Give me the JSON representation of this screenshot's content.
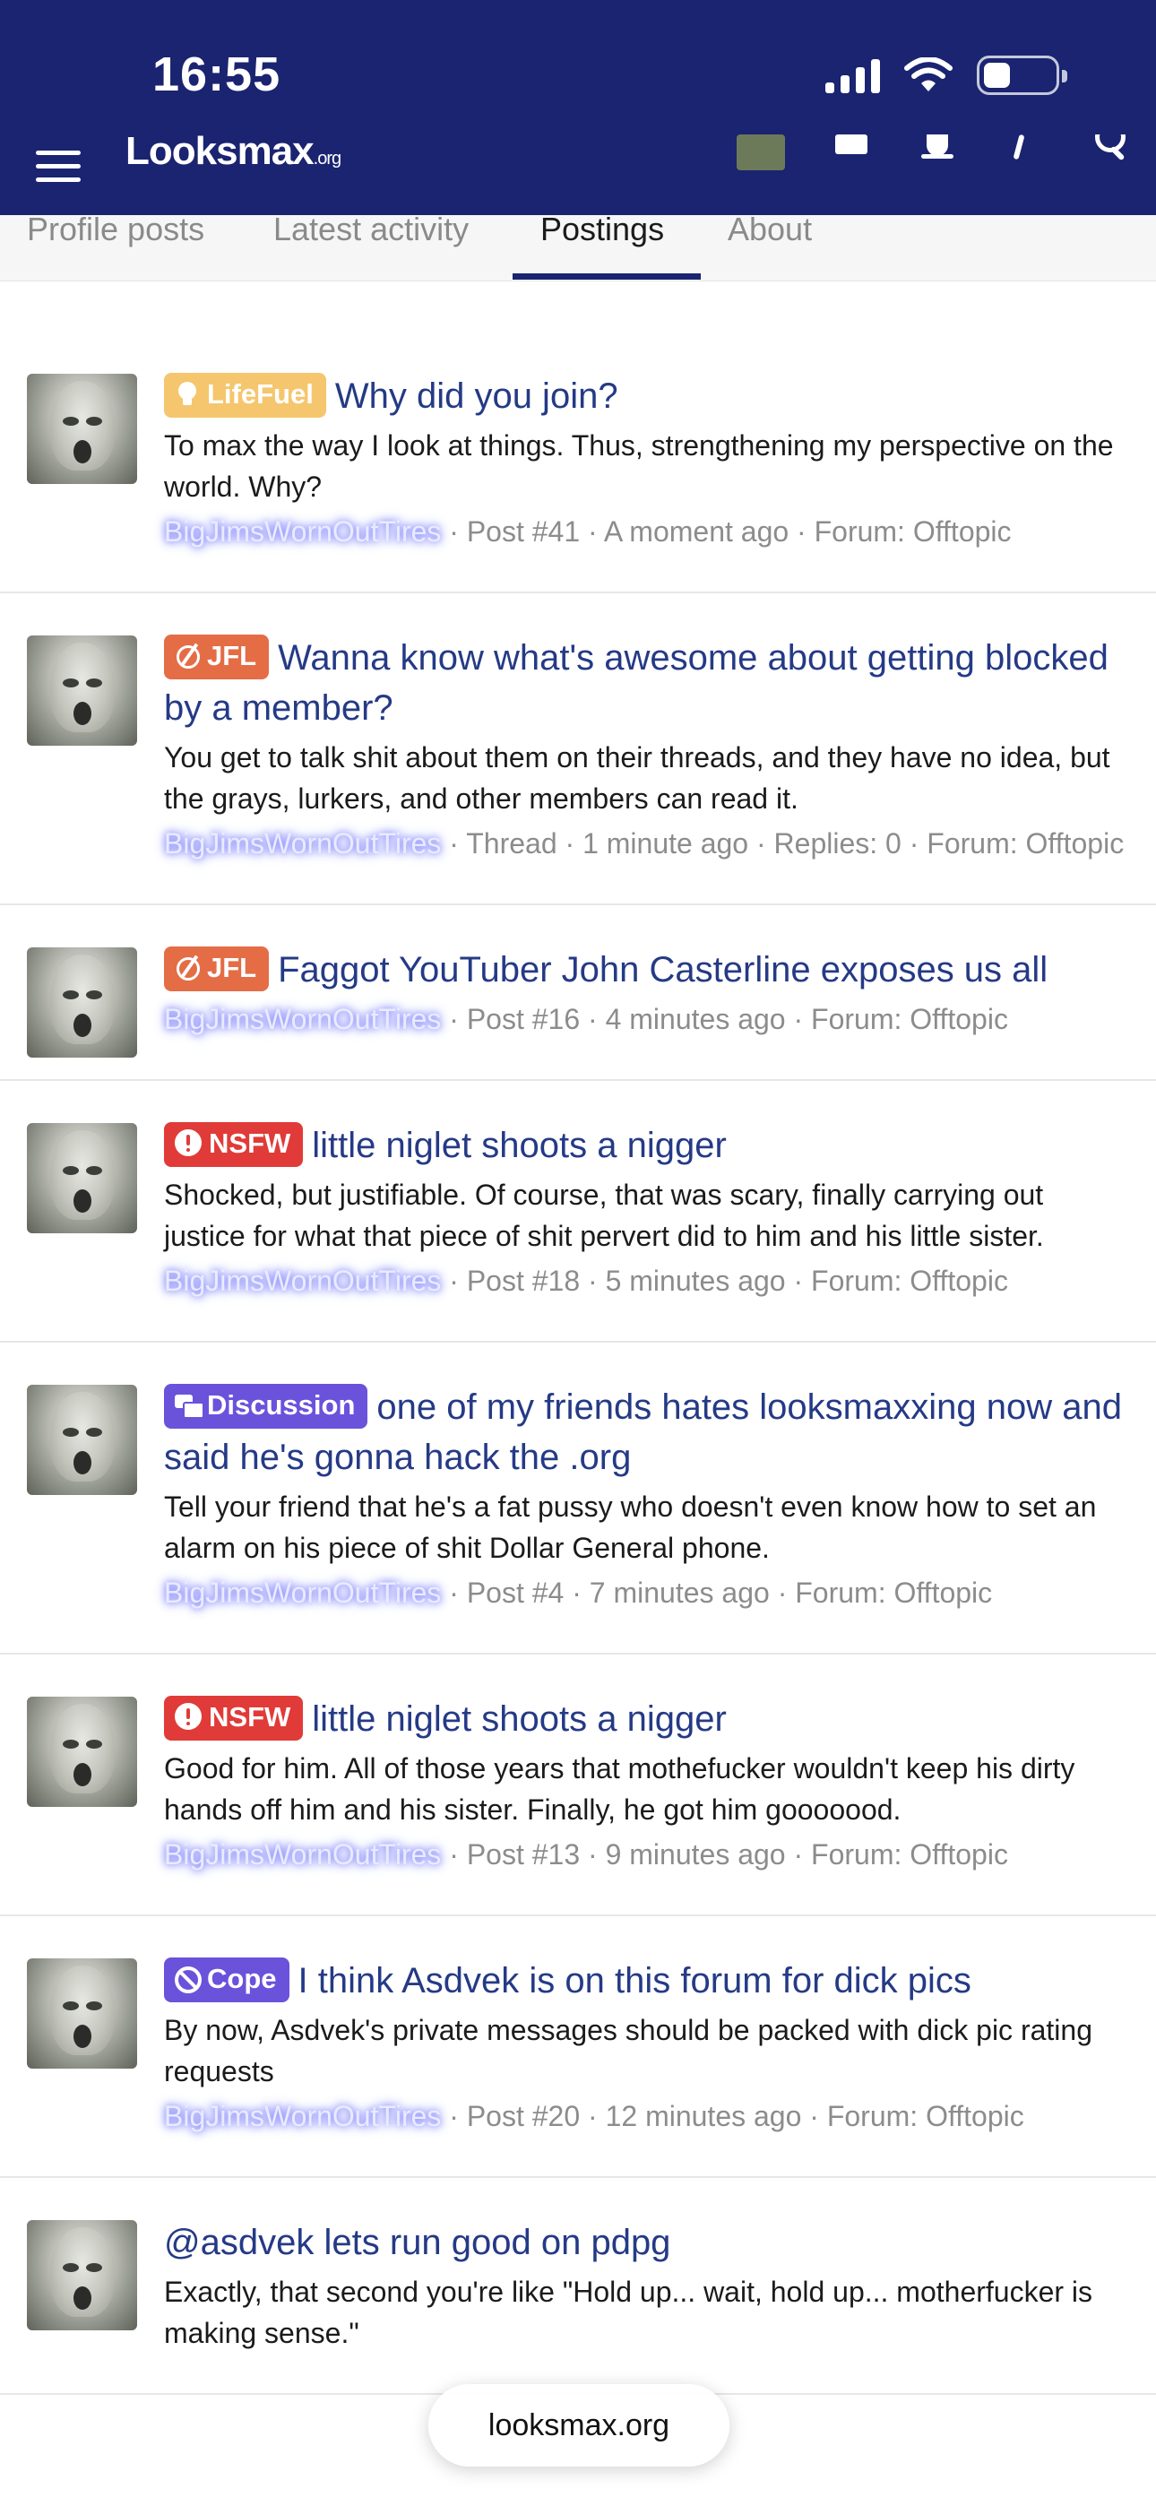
{
  "status_bar": {
    "time": "16:55"
  },
  "header": {
    "logo_main": "Looksmax",
    "logo_suffix": ".org"
  },
  "tabs": [
    {
      "label": "Profile posts"
    },
    {
      "label": "Latest activity"
    },
    {
      "label": "Postings",
      "active": true
    },
    {
      "label": "About"
    }
  ],
  "posts": [
    {
      "prefix": "LifeFuel",
      "title": "Why did you join?",
      "snippet": "To max the way I look at things. Thus, strengthening my perspective on the world. Why?",
      "author": "BigJimsWornOutTires",
      "meta": " · Post #41 · A moment ago · Forum: Offtopic"
    },
    {
      "prefix": "JFL",
      "title": "Wanna know what's awesome about getting blocked by a member?",
      "snippet": "You get to talk shit about them on their threads, and they have no idea, but the grays, lurkers, and other members can read it.",
      "author": "BigJimsWornOutTires",
      "meta": " · Thread · 1 minute ago · Replies: 0 · Forum: Offtopic"
    },
    {
      "prefix": "JFL",
      "title": "Faggot YouTuber John Casterline exposes us all",
      "snippet": "",
      "author": "BigJimsWornOutTires",
      "meta": " · Post #16 · 4 minutes ago · Forum: Offtopic"
    },
    {
      "prefix": "NSFW",
      "title": "little niglet shoots a nigger",
      "snippet": "Shocked, but justifiable. Of course, that was scary, finally carrying out justice for what that piece of shit pervert did to him and his little sister.",
      "author": "BigJimsWornOutTires",
      "meta": " · Post #18 · 5 minutes ago · Forum: Offtopic"
    },
    {
      "prefix": "Discussion",
      "title": "one of my friends hates looksmaxxing now and said he's gonna hack the .org",
      "snippet": "Tell your friend that he's a fat pussy who doesn't even know how to set an alarm on his piece of shit Dollar General phone.",
      "author": "BigJimsWornOutTires",
      "meta": " · Post #4 · 7 minutes ago · Forum: Offtopic"
    },
    {
      "prefix": "NSFW",
      "title": "little niglet shoots a nigger",
      "snippet": "Good for him. All of those years that mothefucker wouldn't keep his dirty hands off him and his sister. Finally, he got him gooooood.",
      "author": "BigJimsWornOutTires",
      "meta": " · Post #13 · 9 minutes ago · Forum: Offtopic"
    },
    {
      "prefix": "Cope",
      "title": "I think Asdvek is on this forum for dick pics",
      "snippet": "By now, Asdvek's private messages should be packed with dick pic rating requests",
      "author": "BigJimsWornOutTires",
      "meta": " · Post #20 · 12 minutes ago · Forum: Offtopic"
    },
    {
      "prefix": "",
      "title": "@asdvek lets run good on pdpg",
      "snippet": "Exactly, that second you're like \"Hold up... wait, hold up... motherfucker is making sense.\"",
      "author": "",
      "meta": ""
    }
  ],
  "url_bar": {
    "domain": "looksmax.org"
  }
}
